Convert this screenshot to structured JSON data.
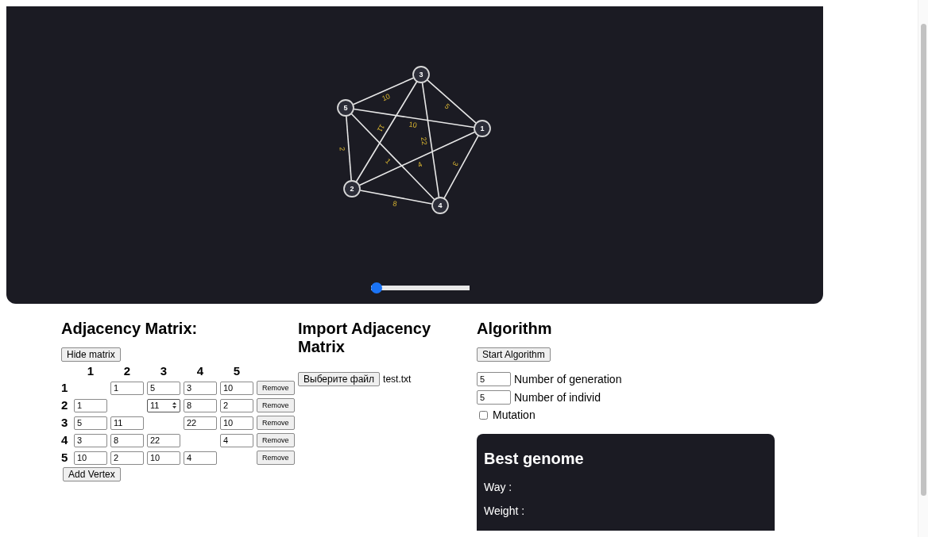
{
  "graph": {
    "nodes": [
      {
        "label": "1"
      },
      {
        "label": "2"
      },
      {
        "label": "3"
      },
      {
        "label": "4"
      },
      {
        "label": "5"
      }
    ],
    "edges": [
      {
        "weight": "10"
      },
      {
        "weight": "5"
      },
      {
        "weight": "10"
      },
      {
        "weight": "11"
      },
      {
        "weight": "22"
      },
      {
        "weight": "2"
      },
      {
        "weight": "4"
      },
      {
        "weight": "1"
      },
      {
        "weight": "8"
      },
      {
        "weight": "3"
      }
    ],
    "slider": {
      "level": 0.0
    }
  },
  "matrix": {
    "title": "Adjacency Matrix:",
    "toggle_button": "Hide matrix",
    "columns": [
      "1",
      "2",
      "3",
      "4",
      "5"
    ],
    "rows": [
      {
        "label": "1",
        "cells": [
          null,
          "1",
          "5",
          "3",
          "10"
        ],
        "remove": "Remove"
      },
      {
        "label": "2",
        "cells": [
          "1",
          null,
          {
            "value": "11",
            "spinner": true
          },
          "8",
          "2"
        ],
        "remove": "Remove"
      },
      {
        "label": "3",
        "cells": [
          "5",
          "11",
          null,
          "22",
          "10"
        ],
        "remove": "Remove"
      },
      {
        "label": "4",
        "cells": [
          "3",
          "8",
          "22",
          null,
          "4"
        ],
        "remove": "Remove"
      },
      {
        "label": "5",
        "cells": [
          "10",
          "2",
          "10",
          "4",
          null
        ],
        "remove": "Remove"
      }
    ],
    "add_button": "Add Vertex"
  },
  "import": {
    "title": "Import Adjacency Matrix",
    "file_button": "Выберите файл",
    "file_name": "test.txt"
  },
  "algorithm": {
    "title": "Algorithm",
    "start_button": "Start Algorithm",
    "fields": [
      {
        "value": "5",
        "label": "Number of generation"
      },
      {
        "value": "5",
        "label": "Number of individ"
      }
    ],
    "mutation": {
      "label": "Mutation",
      "checked": false
    },
    "result": {
      "title": "Best genome",
      "lines": [
        "Way :",
        "Weight :"
      ]
    }
  }
}
